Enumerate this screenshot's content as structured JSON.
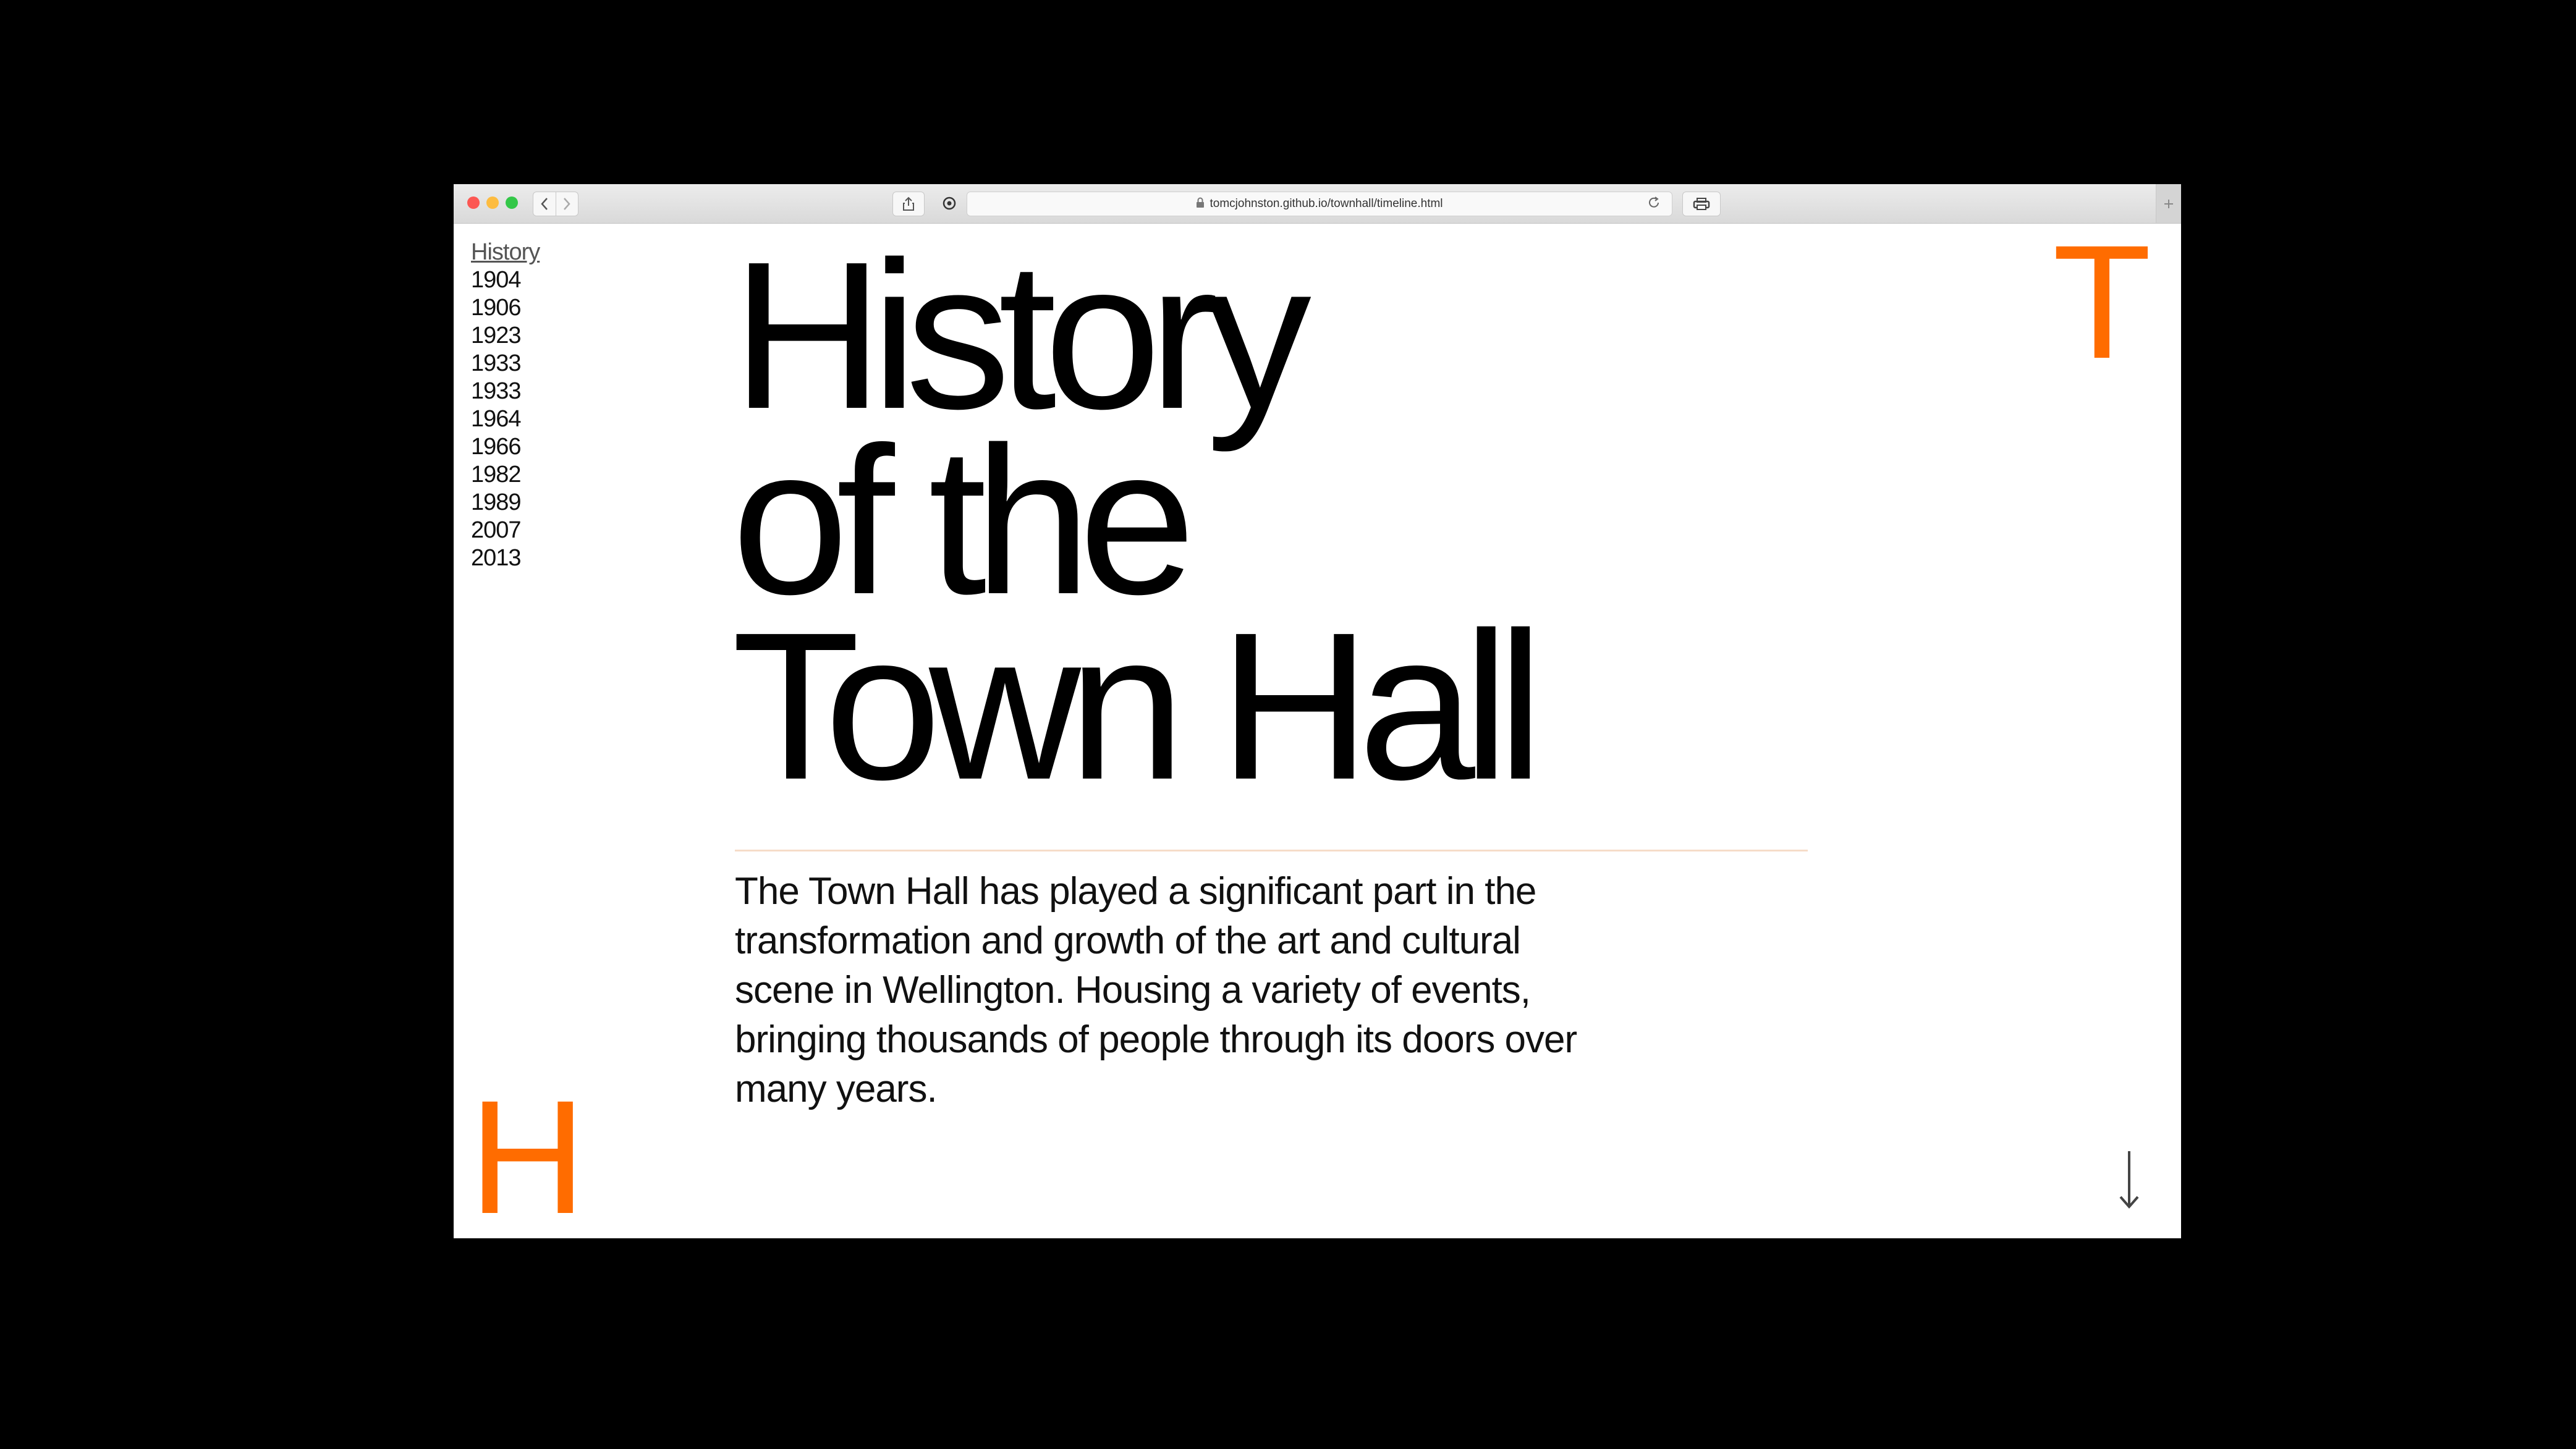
{
  "browser": {
    "url": "tomcjohnston.github.io/townhall/timeline.html",
    "back_icon": "chevron-left-icon",
    "forward_icon": "chevron-right-icon"
  },
  "sidebar": {
    "title": "History",
    "years": [
      "1904",
      "1906",
      "1923",
      "1933",
      "1933",
      "1964",
      "1966",
      "1982",
      "1989",
      "2007",
      "2013"
    ]
  },
  "hero": {
    "title_lines": [
      "History",
      "of the",
      "Town Hall"
    ]
  },
  "intro": {
    "text": "The Town Hall has played a significant part in the transformation and growth of the art and cultural scene in Wellington. Housing a variety of events, bringing thousands of people through its doors over many years."
  },
  "decor": {
    "letter_top": "T",
    "letter_bottom": "H",
    "accent_color": "#ff6c00"
  },
  "scroll": {
    "icon": "arrow-down-icon"
  }
}
